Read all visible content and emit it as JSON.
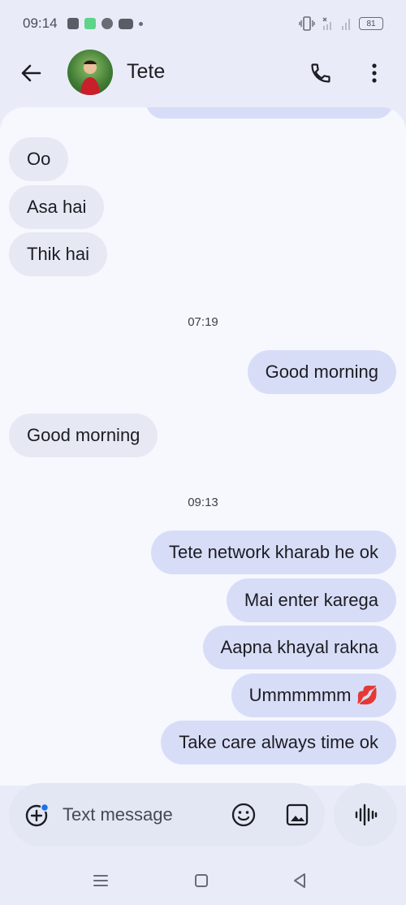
{
  "status_bar": {
    "time": "09:14",
    "battery": "81",
    "icons": [
      "facebook-icon",
      "app-icon",
      "app-icon",
      "youtube-icon",
      "dot-icon",
      "vibrate-icon",
      "no-signal-icon",
      "signal-icon",
      "battery-icon"
    ]
  },
  "header": {
    "contact_name": "Tete",
    "icons": [
      "back-arrow-icon",
      "avatar",
      "phone-icon",
      "more-vert-icon"
    ]
  },
  "messages": [
    {
      "side": "in",
      "text": "Oo"
    },
    {
      "side": "in",
      "text": "Asa hai"
    },
    {
      "side": "in",
      "text": "Thik hai"
    },
    {
      "type": "timestamp",
      "text": "07:19"
    },
    {
      "side": "out",
      "text": "Good morning"
    },
    {
      "side": "in",
      "text": "Good morning"
    },
    {
      "type": "timestamp",
      "text": "09:13"
    },
    {
      "side": "out",
      "text": "Tete network kharab he ok"
    },
    {
      "side": "out",
      "text": "Mai enter karega"
    },
    {
      "side": "out",
      "text": "Aapna khayal rakna"
    },
    {
      "side": "out",
      "text": "Ummmmmm 💋"
    },
    {
      "side": "out",
      "text": "Take care always time ok"
    }
  ],
  "composer": {
    "placeholder": "Text message",
    "icons": [
      "add-circle-icon",
      "emoji-icon",
      "gallery-icon",
      "voice-waveform-icon"
    ]
  },
  "navigation": {
    "icons": [
      "menu-icon",
      "home-square-icon",
      "back-triangle-icon"
    ]
  },
  "colors": {
    "background": "#e9ecf8",
    "chat_background": "#f6f8fe",
    "incoming_bubble": "#e6e9f4",
    "outgoing_bubble": "#d8ddf7",
    "accent_dot": "#1a73e8"
  }
}
